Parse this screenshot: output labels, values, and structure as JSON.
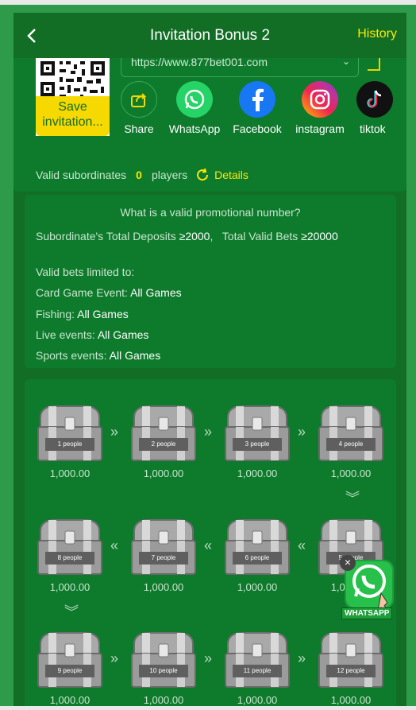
{
  "header": {
    "title": "Invitation Bonus 2",
    "history_label": "History"
  },
  "share": {
    "qr_save_label": "Save invitation...",
    "url_value": "https://www.877bet001.com",
    "items": [
      {
        "label": "Share",
        "icon": "share-icon"
      },
      {
        "label": "WhatsApp",
        "icon": "whatsapp-icon"
      },
      {
        "label": "Facebook",
        "icon": "facebook-icon"
      },
      {
        "label": "instagram",
        "icon": "instagram-icon"
      },
      {
        "label": "tiktok",
        "icon": "tiktok-icon"
      }
    ],
    "valid_prefix": "Valid subordinates",
    "valid_count": "0",
    "valid_suffix": "players",
    "details_label": "Details"
  },
  "rules": {
    "title": "What is a valid promotional number?",
    "deposits_label": "Subordinate's Total Deposits",
    "deposits_value": "≥2000",
    "bets_label": "Total Valid Bets",
    "bets_value": "≥20000",
    "limited_label": "Valid bets limited to:",
    "lines": [
      {
        "label": "Card Game Event:",
        "value": "All Games"
      },
      {
        "label": "Fishing:",
        "value": "All Games"
      },
      {
        "label": "Live events:",
        "value": "All Games"
      },
      {
        "label": "Sports events:",
        "value": "All Games"
      }
    ]
  },
  "chests": [
    {
      "people": "1 people",
      "amount": "1,000.00"
    },
    {
      "people": "2 people",
      "amount": "1,000.00"
    },
    {
      "people": "3 people",
      "amount": "1,000.00"
    },
    {
      "people": "4 people",
      "amount": "1,000.00"
    },
    {
      "people": "8 people",
      "amount": "1,000.00"
    },
    {
      "people": "7 people",
      "amount": "1,000.00"
    },
    {
      "people": "6 people",
      "amount": "1,000.00"
    },
    {
      "people": "5 people",
      "amount": "1,000.00"
    },
    {
      "people": "9 people",
      "amount": "1,000.00"
    },
    {
      "people": "10 people",
      "amount": "1,000.00"
    },
    {
      "people": "11 people",
      "amount": "1,000.00"
    },
    {
      "people": "12 people",
      "amount": "1,000.00"
    }
  ],
  "whatsapp_float": {
    "label": "WHATSAPP",
    "close_glyph": "×"
  },
  "colors": {
    "accent_yellow": "#ffe800",
    "bg_green": "#126e25",
    "card_green": "#0e7a2c"
  }
}
